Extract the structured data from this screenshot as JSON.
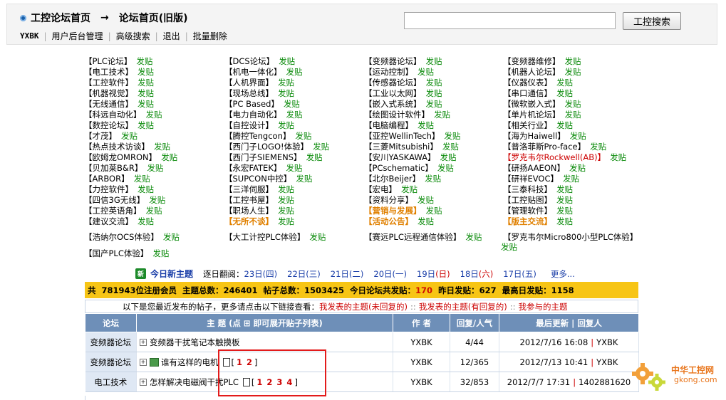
{
  "header": {
    "breadcrumb_home": "工控论坛首页",
    "breadcrumb_arrow": "→",
    "breadcrumb_current": "论坛首页(旧版)",
    "username": "YXBK",
    "links": [
      "用户后台管理",
      "高级搜索",
      "退出",
      "批量删除"
    ],
    "search_placeholder": "",
    "search_button": "工控搜索"
  },
  "forums": [
    [
      {
        "name": "【PLC论坛】",
        "post": "发贴"
      },
      {
        "name": "【电工技术】",
        "post": "发贴"
      },
      {
        "name": "【工控软件】",
        "post": "发贴"
      },
      {
        "name": "【机器视觉】",
        "post": "发贴"
      },
      {
        "name": "【无线通信】",
        "post": "发贴"
      },
      {
        "name": "【科远自动化】",
        "post": "发贴"
      },
      {
        "name": "【数控论坛】",
        "post": "发贴"
      },
      {
        "name": "【才茂】",
        "post": "发贴"
      },
      {
        "name": "【热点技术访谈】",
        "post": "发贴"
      },
      {
        "name": "【欧姆龙OMRON】",
        "post": "发贴"
      },
      {
        "name": "【贝加莱B&R】",
        "post": "发贴"
      },
      {
        "name": "【ARBOR】",
        "post": "发贴"
      },
      {
        "name": "【力控软件】",
        "post": "发贴"
      },
      {
        "name": "【四信3G无线】",
        "post": "发贴"
      },
      {
        "name": "【工控英语角】",
        "post": "发贴"
      },
      {
        "name": "【建议交流】",
        "post": "发贴"
      },
      {
        "name": "【浩纳尔OCS体验】",
        "post": "发贴"
      },
      {
        "name": "【国产PLC体验】",
        "post": "发贴"
      }
    ],
    [
      {
        "name": "【DCS论坛】",
        "post": "发贴"
      },
      {
        "name": "【机电一体化】",
        "post": "发贴"
      },
      {
        "name": "【人机界面】",
        "post": "发贴"
      },
      {
        "name": "【现场总线】",
        "post": "发贴"
      },
      {
        "name": "【PC Based】",
        "post": "发贴"
      },
      {
        "name": "【电力自动化】",
        "post": "发贴"
      },
      {
        "name": "【自控设计】",
        "post": "发贴"
      },
      {
        "name": "【腾控Tengcon】",
        "post": "发贴"
      },
      {
        "name": "【西门子LOGO!体验】",
        "post": "发贴"
      },
      {
        "name": "【西门子SIEMENS】",
        "post": "发贴"
      },
      {
        "name": "【永宏FATEK】",
        "post": "发贴"
      },
      {
        "name": "【SUPCON中控】",
        "post": "发贴"
      },
      {
        "name": "【三洋伺服】",
        "post": "发贴"
      },
      {
        "name": "【工控书屋】",
        "post": "发贴"
      },
      {
        "name": "【职场人生】",
        "post": "发贴"
      },
      {
        "name": "【无所不谈】",
        "post": "发贴",
        "style": "orange"
      },
      {
        "name": "【大工计控PLC体验】",
        "post": "发贴"
      }
    ],
    [
      {
        "name": "【变频器论坛】",
        "post": "发贴"
      },
      {
        "name": "【运动控制】",
        "post": "发贴"
      },
      {
        "name": "【传感器论坛】",
        "post": "发贴"
      },
      {
        "name": "【工业以太网】",
        "post": "发贴"
      },
      {
        "name": "【嵌入式系统】",
        "post": "发贴"
      },
      {
        "name": "【绘图设计软件】",
        "post": "发贴"
      },
      {
        "name": "【电脑编程】",
        "post": "发贴"
      },
      {
        "name": "【亚控WellinTech】",
        "post": "发贴"
      },
      {
        "name": "【三菱Mitsubishi】",
        "post": "发贴"
      },
      {
        "name": "【安川YASKAWA】",
        "post": "发贴"
      },
      {
        "name": "【PCschematic】",
        "post": "发贴"
      },
      {
        "name": "【北尔Beijer】",
        "post": "发贴"
      },
      {
        "name": "【宏电】",
        "post": "发贴"
      },
      {
        "name": "【资料分享】",
        "post": "发贴"
      },
      {
        "name": "【营销与发展】",
        "post": "发贴",
        "style": "orange"
      },
      {
        "name": "【活动公告】",
        "post": "发贴",
        "style": "orange"
      },
      {
        "name": "【赛远PLC远程通信体验】",
        "post": "发贴"
      }
    ],
    [
      {
        "name": "【变频器维修】",
        "post": "发贴"
      },
      {
        "name": "【机器人论坛】",
        "post": "发贴"
      },
      {
        "name": "【仪器仪表】",
        "post": "发贴"
      },
      {
        "name": "【串口通信】",
        "post": "发贴"
      },
      {
        "name": "【微软嵌入式】",
        "post": "发贴"
      },
      {
        "name": "【单片机论坛】",
        "post": "发贴"
      },
      {
        "name": "【相关行业】",
        "post": "发贴"
      },
      {
        "name": "【海为Haiwell】",
        "post": "发贴"
      },
      {
        "name": "【普洛菲斯Pro-face】",
        "post": "发贴"
      },
      {
        "name": "【罗克韦尔Rockwell(AB)】",
        "post": "发贴",
        "style": "red"
      },
      {
        "name": "【研扬AAEON】",
        "post": "发贴"
      },
      {
        "name": "【研祥EVOC】",
        "post": "发贴"
      },
      {
        "name": "【三泰科技】",
        "post": "发贴"
      },
      {
        "name": "【工控贴图】",
        "post": "发贴"
      },
      {
        "name": "【管理软件】",
        "post": "发贴"
      },
      {
        "name": "【版主交流】",
        "post": "发贴",
        "style": "orange"
      },
      {
        "name": "【罗克韦尔Micro800小型PLC体验】",
        "post": "发贴"
      }
    ]
  ],
  "new_topics": {
    "badge": "新",
    "title": "今日新主题",
    "prefix": "逐日翻阅：",
    "days": [
      {
        "date": "23日",
        "wd": "(四)",
        "style": ""
      },
      {
        "date": "22日",
        "wd": "(三)",
        "style": ""
      },
      {
        "date": "21日",
        "wd": "(二)",
        "style": ""
      },
      {
        "date": "20日",
        "wd": "(一)",
        "style": ""
      },
      {
        "date": "19日",
        "wd": "(日)",
        "style": "red"
      },
      {
        "date": "18日",
        "wd": "(六)",
        "style": "red"
      },
      {
        "date": "17日",
        "wd": "(五)",
        "style": ""
      }
    ],
    "more": "更多..."
  },
  "stats": {
    "t1": "共",
    "members": "781943",
    "t2": "位注册会员",
    "t3": "主题总数：",
    "topics": "246401",
    "t4": "帖子总数：",
    "posts": "1503425",
    "t5": "今日论坛共发贴：",
    "today": "170",
    "t6": "昨日发贴：",
    "yesterday": "627",
    "t7": "最高日发贴：",
    "max": "1158"
  },
  "recent": {
    "text": "以下是您最近发布的帖子，更多请点击以下链接查看：",
    "link1": "我发表的主题(未回复的)",
    "link2": "我发表的主题(有回复的)",
    "link3": "我参与的主题",
    "sep": "::"
  },
  "table": {
    "headers": [
      "论坛",
      "主 题 (点 ⊞ 即可展开贴子列表)",
      "作 者",
      "回复/人气",
      "最后更新 | 回复人"
    ],
    "rows": [
      {
        "forum": "变频器论坛",
        "title": "变频器干扰笔记本触摸板",
        "pages": [],
        "author": "YXBK",
        "stats": "4/44",
        "last": "2012/7/16 16:08",
        "replier": "YXBK",
        "pic": false
      },
      {
        "forum": "变频器论坛",
        "title": "谁有这样的电机",
        "pages": [
          "1",
          "2"
        ],
        "author": "YXBK",
        "stats": "12/365",
        "last": "2012/7/13 10:41",
        "replier": "YXBK",
        "pic": true
      },
      {
        "forum": "电工技术",
        "title": "怎样解决电磁阀干扰PLC",
        "pages": [
          "1",
          "2",
          "3",
          "4"
        ],
        "author": "YXBK",
        "stats": "32/853",
        "last": "2012/7/7 17:31",
        "replier": "1402881620",
        "pic": false
      }
    ]
  },
  "watermark": {
    "cn": "中华工控网",
    "en": "gkong.com"
  },
  "colors": {
    "header_bg": "#f4f4f4",
    "table_header": "#6e8fb8",
    "stats_bg": "#f7c515",
    "post_link": "#0a8a0a",
    "highlight_red": "#cc0000"
  }
}
